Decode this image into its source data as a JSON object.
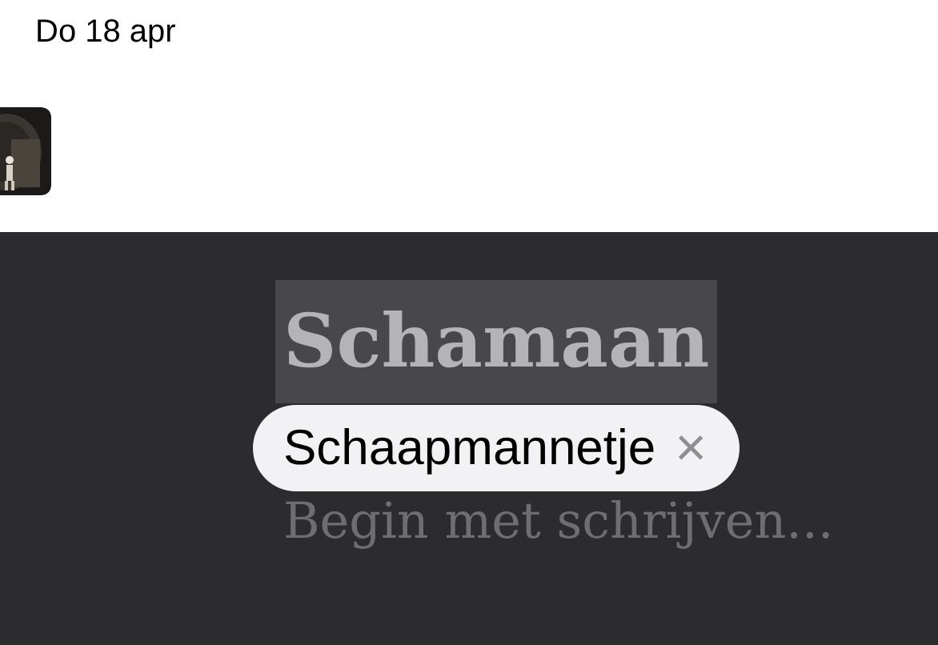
{
  "date": "Do 18 apr",
  "editor": {
    "title": "Schamaan",
    "title_selected": true,
    "body_placeholder": "Begin met schrijven..."
  },
  "suggestion": {
    "text": "Schaapmannetje",
    "dismiss": "×"
  }
}
